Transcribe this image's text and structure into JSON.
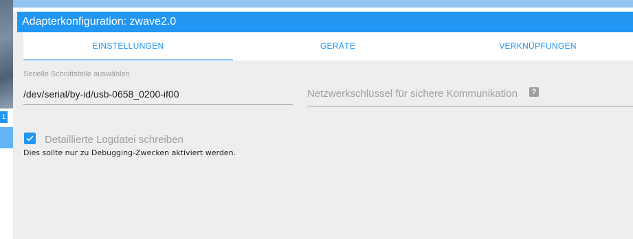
{
  "dialog": {
    "title": "Adapterkonfiguration: zwave2.0"
  },
  "tabs": [
    {
      "label": "EINSTELLUNGEN",
      "active": true
    },
    {
      "label": "GERÄTE",
      "active": false
    },
    {
      "label": "VERKNÜPFUNGEN",
      "active": false
    }
  ],
  "settings": {
    "serial_label": "Serielle Schnittstelle auswählen",
    "serial_value": "/dev/serial/by-id/usb-0658_0200-if00",
    "network_key_label": "Netzwerkschlüssel für sichere Kommunikation",
    "network_key_help_icon": "question-mark-icon",
    "log_checkbox_label": "Detaillierte Logdatei schreiben",
    "log_checkbox_checked": true,
    "log_help_text": "Dies sollte nur zu Debugging-Zwecken aktiviert werden."
  },
  "background": {
    "badge_text": "1"
  },
  "colors": {
    "accent": "#2196f3",
    "tab_indicator": "#90caf9",
    "panel_background": "#eeeeee",
    "muted_text": "#9e9e9e"
  }
}
